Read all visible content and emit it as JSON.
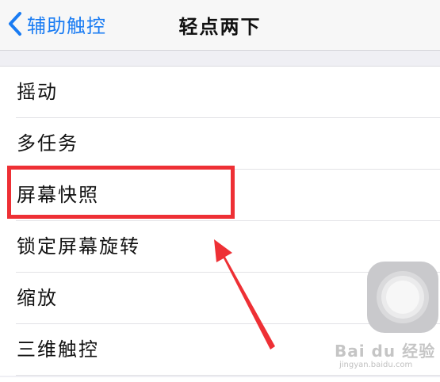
{
  "navbar": {
    "back_label": "辅助触控",
    "title": "轻点两下"
  },
  "list": {
    "items": [
      {
        "label": "摇动"
      },
      {
        "label": "多任务"
      },
      {
        "label": "屏幕快照"
      },
      {
        "label": "锁定屏幕旋转"
      },
      {
        "label": "缩放"
      },
      {
        "label": "三维触控"
      }
    ]
  },
  "annotation": {
    "highlight_color": "#ee3035",
    "highlighted_item": "屏幕快照"
  },
  "watermark": {
    "logo": "Bai du 经验",
    "sub": "jingyan.baidu.com"
  },
  "colors": {
    "accent": "#1a7cf3",
    "background": "#efeff4",
    "annotation_red": "#ee3035"
  }
}
